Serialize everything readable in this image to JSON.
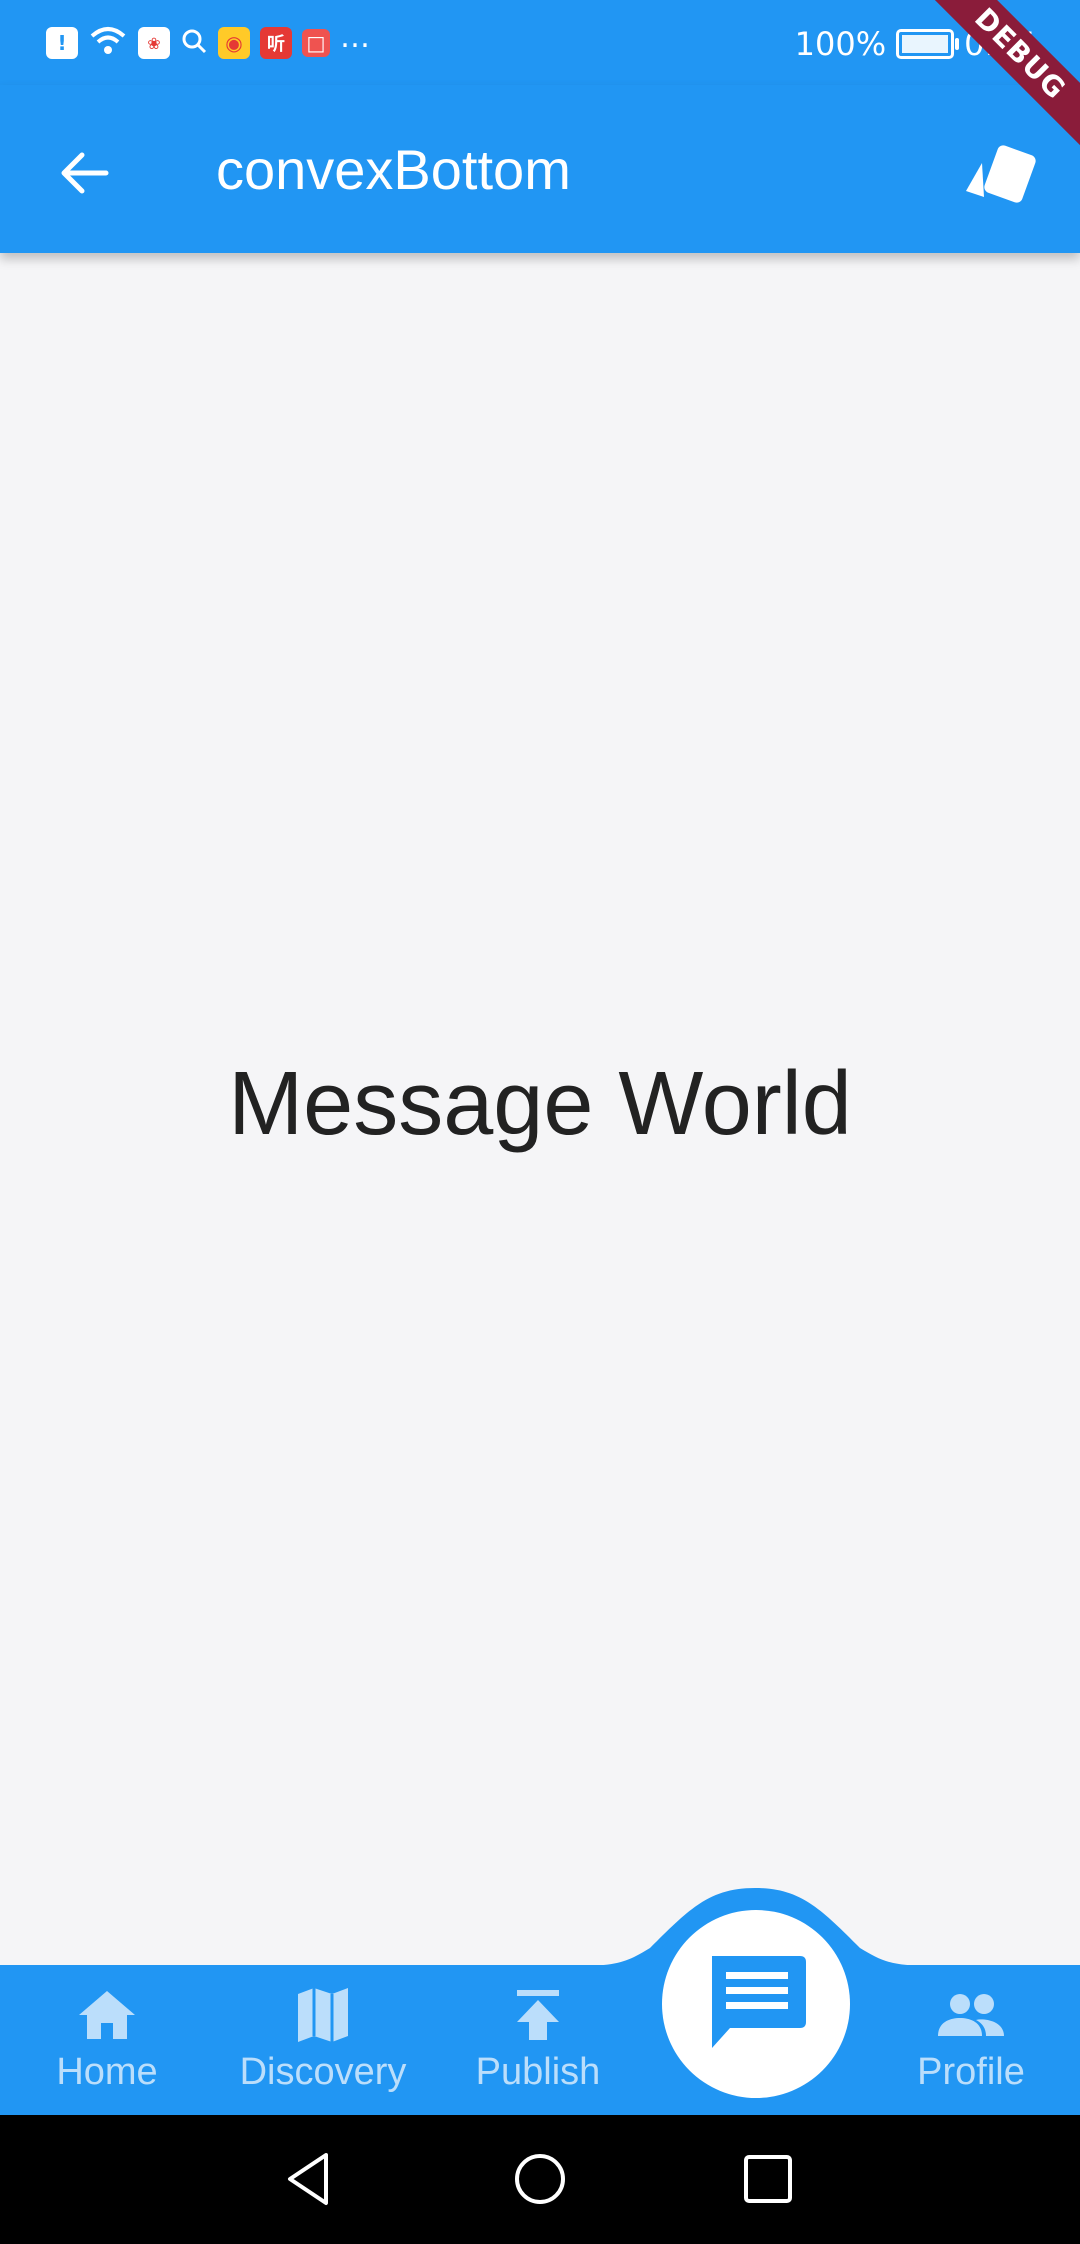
{
  "status_bar": {
    "battery": "100%",
    "time": "0:15"
  },
  "debug_banner": "DEBUG",
  "app_bar": {
    "title": "convexBottom"
  },
  "content": {
    "text": "Message World"
  },
  "bottom_tabs": [
    {
      "label": "Home",
      "icon": "home-icon"
    },
    {
      "label": "Discovery",
      "icon": "map-icon"
    },
    {
      "label": "Publish",
      "icon": "publish-icon"
    },
    {
      "label": "Message",
      "icon": "message-icon",
      "active": true
    },
    {
      "label": "Profile",
      "icon": "people-icon"
    }
  ],
  "colors": {
    "primary": "#2196f3",
    "inactive_tab": "#bbdefb",
    "background": "#f5f5f7",
    "debug": "#8a1c3a"
  }
}
